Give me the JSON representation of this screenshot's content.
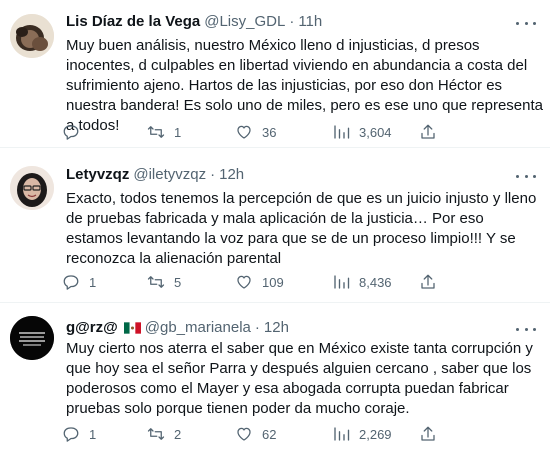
{
  "tweets": [
    {
      "name": "Lis Díaz de la Vega",
      "handle": "@Lisy_GDL",
      "dot": "·",
      "time": "11h",
      "text": "Muy buen análisis, nuestro México lleno d injusticias, d presos inocentes, d culpables en libertad viviendo en abundancia a costa del sufrimiento ajeno. Hartos de las injusticias, por eso don Héctor es nuestra bandera! Es solo uno de miles, pero es ese uno que representa a todos!",
      "replies": "",
      "retweets": "1",
      "likes": "36",
      "views": "3,604"
    },
    {
      "name": "Letyvzqz",
      "handle": "@iletyvzqz",
      "dot": "·",
      "time": "12h",
      "text": "Exacto, todos tenemos la percepción de que es un juicio injusto y lleno de pruebas fabricada y mala aplicación de la justicia… Por eso estamos levantando la voz para que se de un proceso limpio!!! Y se reconozca la alienación parental",
      "replies": "1",
      "retweets": "5",
      "likes": "109",
      "views": "8,436"
    },
    {
      "name": "g@rz@",
      "handle": "@gb_marianela",
      "dot": "·",
      "time": "12h",
      "text": "Muy cierto nos aterra el saber que en México existe tanta corrupción y que hoy sea el señor Parra y después alguien cercano  , saber que los poderosos como el Mayer y esa abogada corrupta puedan fabricar pruebas solo porque tienen poder da mucho coraje.",
      "replies": "1",
      "retweets": "2",
      "likes": "62",
      "views": "2,269"
    }
  ],
  "colors": {
    "text": "#0f1419",
    "secondary": "#536471",
    "divider": "#eff3f4"
  },
  "icons": [
    "reply-icon",
    "retweet-icon",
    "like-icon",
    "views-icon",
    "share-icon",
    "more-icon",
    "mexico-flag-icon"
  ]
}
